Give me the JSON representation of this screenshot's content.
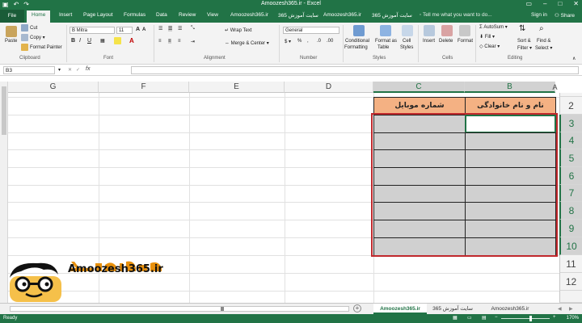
{
  "window": {
    "title": "Amoozesh365.ir - Excel"
  },
  "tabs": {
    "file": "File",
    "home": "Home",
    "insert": "Insert",
    "page_layout": "Page Layout",
    "formulas": "Formulas",
    "data": "Data",
    "review": "Review",
    "view": "View",
    "amoozesh1": "Amoozesh365.ir",
    "site1": "سایت آموزش 365",
    "amoozesh2": "Amoozesh365.ir",
    "site2": "سایت آموزش 365",
    "tell_me": "Tell me what you want to do...",
    "sign_in": "Sign in",
    "share": "Share"
  },
  "ribbon": {
    "clipboard": {
      "paste": "Paste",
      "cut": "Cut",
      "copy": "Copy",
      "format_painter": "Format Painter",
      "label": "Clipboard"
    },
    "font": {
      "name": "B Mitra",
      "size": "11",
      "bold": "B",
      "italic": "I",
      "underline": "U",
      "grow": "A",
      "shrink": "A",
      "label": "Font"
    },
    "alignment": {
      "wrap_text": "Wrap Text",
      "merge_center": "Merge & Center",
      "label": "Alignment"
    },
    "number": {
      "format": "General",
      "label": "Number",
      "percent": "%",
      "comma": ","
    },
    "styles": {
      "conditional": "Conditional",
      "conditional2": "Formatting",
      "format_as": "Format as",
      "table": "Table",
      "cell": "Cell",
      "cell_styles": "Styles",
      "label": "Styles"
    },
    "cells": {
      "insert": "Insert",
      "delete": "Delete",
      "format": "Format",
      "label": "Cells"
    },
    "editing": {
      "autosum": "AutoSum",
      "fill": "Fill",
      "clear": "Clear",
      "sort": "Sort &",
      "filter": "Filter",
      "find": "Find &",
      "select": "Select",
      "label": "Editing"
    }
  },
  "formula_bar": {
    "name_box": "B3",
    "fx": "fx",
    "value": ""
  },
  "columns": [
    "G",
    "F",
    "E",
    "D",
    "C",
    "B",
    "A"
  ],
  "rows": [
    "2",
    "3",
    "4",
    "5",
    "6",
    "7",
    "8",
    "9",
    "10",
    "11",
    "12"
  ],
  "table": {
    "header_b": "نام و نام خانوادگی",
    "header_c": "شماره موبایل"
  },
  "sheets": {
    "active": "Amoozesh365.ir",
    "second": "سایت آموزش 365",
    "third": "Amoozesh365.ir"
  },
  "status": {
    "ready": "Ready",
    "zoom": "170%"
  },
  "logo": {
    "text": "Amoozesh365.ir",
    "accent": "#e8900c"
  },
  "colors": {
    "excel_green": "#217346",
    "header_fill": "#f4b183",
    "gray_fill": "#d0d0d0",
    "highlight": "#c0282c"
  }
}
